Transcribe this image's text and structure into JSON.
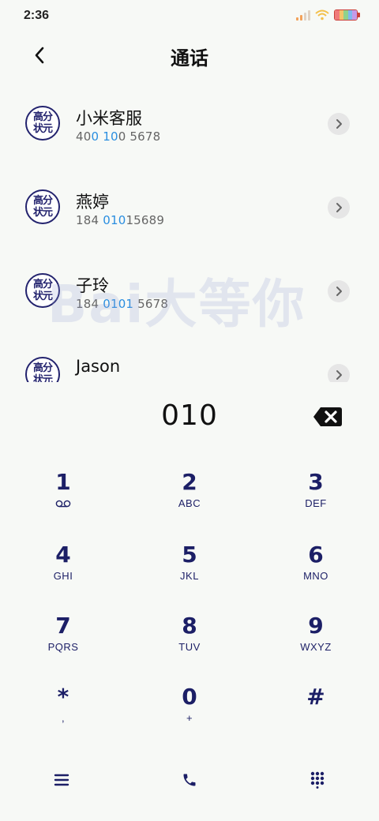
{
  "status_bar": {
    "time": "2:36"
  },
  "header": {
    "title": "通话"
  },
  "contacts": [
    {
      "avatar_line1": "高分",
      "avatar_line2": "状元",
      "name": "小米客服",
      "number_pre": "40",
      "number_hl": "0 10",
      "number_post": "0 5678"
    },
    {
      "avatar_line1": "高分",
      "avatar_line2": "状元",
      "name": "燕婷",
      "number_pre": "184 ",
      "number_hl": "010",
      "number_post": "15689"
    },
    {
      "avatar_line1": "高分",
      "avatar_line2": "状元",
      "name": "子玲",
      "number_pre": "184 ",
      "number_hl": "0101",
      "number_post": " 5678"
    },
    {
      "avatar_line1": "高分",
      "avatar_line2": "状元",
      "name": "Jason",
      "number_pre": "",
      "number_hl": "",
      "number_post": ""
    }
  ],
  "watermark": "Bai大等你",
  "dialer": {
    "input": "010"
  },
  "keypad": [
    {
      "digit": "1",
      "letters": ""
    },
    {
      "digit": "2",
      "letters": "ABC"
    },
    {
      "digit": "3",
      "letters": "DEF"
    },
    {
      "digit": "4",
      "letters": "GHI"
    },
    {
      "digit": "5",
      "letters": "JKL"
    },
    {
      "digit": "6",
      "letters": "MNO"
    },
    {
      "digit": "7",
      "letters": "PQRS"
    },
    {
      "digit": "8",
      "letters": "TUV"
    },
    {
      "digit": "9",
      "letters": "WXYZ"
    },
    {
      "digit": "*",
      "letters": ","
    },
    {
      "digit": "0",
      "letters": "+"
    },
    {
      "digit": "#",
      "letters": ""
    }
  ],
  "icons": {
    "back": "chevron-left-icon",
    "detail": "chevron-right-icon",
    "backspace": "backspace-icon",
    "voicemail": "voicemail-icon",
    "menu": "menu-icon",
    "call": "phone-icon",
    "dialpad": "dialpad-icon"
  },
  "colors": {
    "accent": "#1c1f66",
    "highlight": "#2a8ee0",
    "background": "#f7f9f6"
  }
}
